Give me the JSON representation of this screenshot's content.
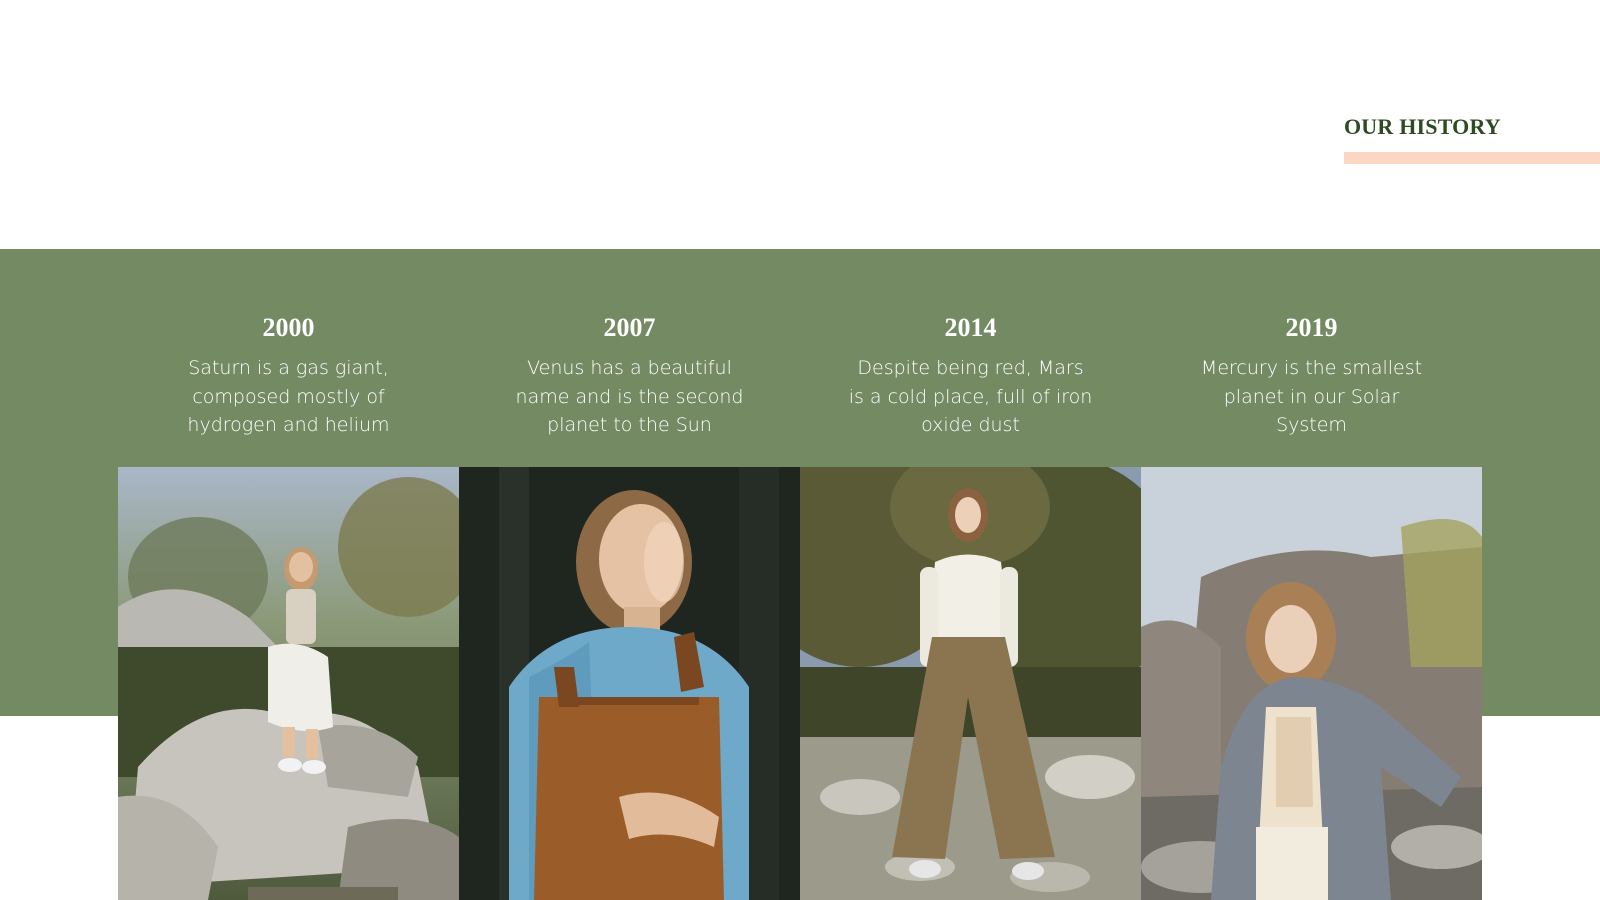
{
  "header": {
    "title": "OUR HISTORY"
  },
  "colors": {
    "accent_green": "#738a63",
    "title_green": "#2d4a22",
    "underline_peach": "#fbd6c4"
  },
  "timeline": [
    {
      "year": "2000",
      "description": "Saturn is a gas giant, composed mostly of hydrogen and helium",
      "photo": "woman-sitting-on-rock-photo"
    },
    {
      "year": "2007",
      "description": "Venus has a beautiful name and is the second planet to the Sun",
      "photo": "woman-in-overalls-photo"
    },
    {
      "year": "2014",
      "description": "Despite being red, Mars is a cold place, full of iron oxide dust",
      "photo": "woman-standing-in-forest-photo"
    },
    {
      "year": "2019",
      "description": "Mercury is the smallest planet in our Solar System",
      "photo": "woman-in-grey-coat-photo"
    }
  ]
}
